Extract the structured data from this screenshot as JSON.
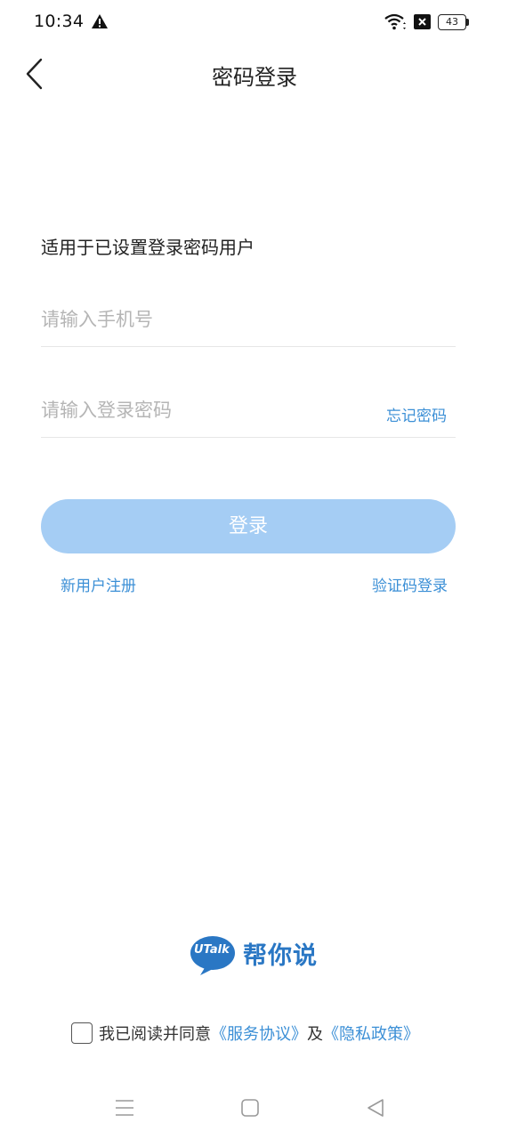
{
  "status_bar": {
    "time": "10:34",
    "battery": "43",
    "icons": [
      "warning-icon",
      "wifi-icon",
      "sim-blocked-icon",
      "battery-icon"
    ]
  },
  "header": {
    "title": "密码登录",
    "back_icon": "chevron-left-icon"
  },
  "form": {
    "subtitle": "适用于已设置登录密码用户",
    "phone_placeholder": "请输入手机号",
    "phone_value": "",
    "password_placeholder": "请输入登录密码",
    "password_value": "",
    "forgot_label": "忘记密码",
    "login_label": "登录",
    "register_label": "新用户注册",
    "sms_login_label": "验证码登录"
  },
  "logo": {
    "badge_text": "UTalk",
    "name": "帮你说"
  },
  "agreement": {
    "prefix": "我已阅读并同意",
    "service_link": "《服务协议》",
    "middle": "及",
    "privacy_link": "《隐私政策》",
    "checked": false
  },
  "system_nav": {
    "icons": [
      "menu-icon",
      "home-icon",
      "back-triangle-icon"
    ]
  },
  "colors": {
    "accent": "#3b8fd6",
    "button_disabled": "#a5cdf4",
    "logo_blue": "#2a77c4",
    "placeholder": "#b5b5b5"
  }
}
